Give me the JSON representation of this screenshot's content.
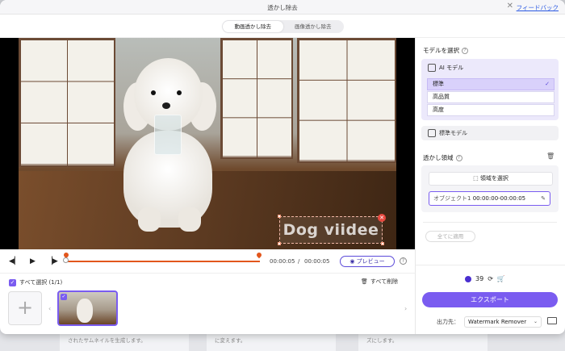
{
  "window": {
    "title": "透かし除去",
    "feedback": "フィードバック"
  },
  "tabs": [
    {
      "label": "動画透かし除去",
      "active": true
    },
    {
      "label": "画像透かし除去",
      "active": false
    }
  ],
  "video": {
    "watermark_text": "Dog viidee",
    "time_current": "00:00:05",
    "time_separator": "/",
    "time_total": "00:00:05",
    "preview_label": "プレビュー"
  },
  "thumbnails": {
    "select_all": "すべて選択 (1/1)",
    "delete_all": "すべて削除"
  },
  "panel": {
    "model_heading": "モデルを選択",
    "ai_model": "AI モデル",
    "options": [
      {
        "label": "標準",
        "selected": true
      },
      {
        "label": "高品質",
        "selected": false
      },
      {
        "label": "高度",
        "selected": false
      }
    ],
    "standard_model": "標準モデル",
    "region_heading": "透かし領域",
    "select_region": "領域を選択",
    "object_name": "オブジェクト1",
    "object_time": "00:00:00-00:00:05",
    "apply_all": "全てに適用",
    "credits": "39",
    "export": "エクスポート",
    "output_label": "出力先：",
    "output_value": "Watermark Remover"
  },
  "background": {
    "card1": "されたサムネイルを生成します。",
    "card2": "に変えます。",
    "card3": "ズにします。"
  },
  "colors": {
    "accent": "#7a5cf0",
    "timeline": "#e2561c",
    "close": "#e8493f"
  }
}
